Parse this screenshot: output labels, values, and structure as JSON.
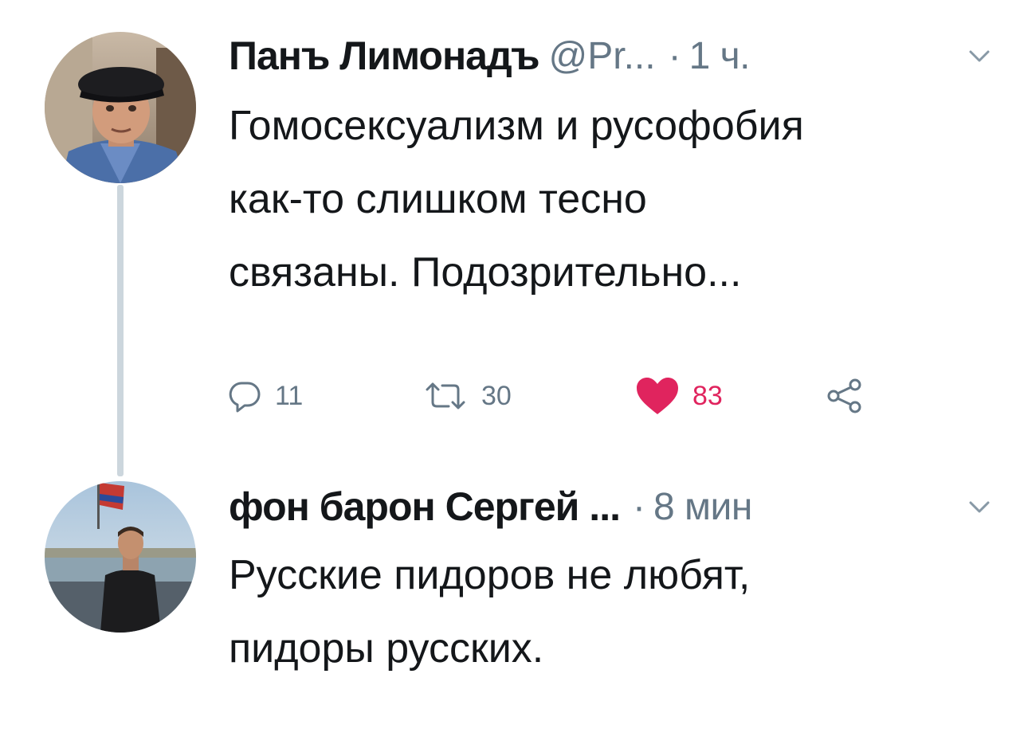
{
  "thread": {
    "tweets": [
      {
        "author_name": "Панъ Лимонадъ",
        "handle": "@Pr...",
        "separator": "·",
        "time": "1 ч.",
        "avatar_icon": "avatar-man-in-cap",
        "text_lines": [
          "Гомосексуализм и русофобия",
          "как-то слишком тесно",
          "связаны. Подозрительно..."
        ],
        "actions": {
          "reply": {
            "icon": "reply-icon",
            "count": "11"
          },
          "retweet": {
            "icon": "retweet-icon",
            "count": "30"
          },
          "like": {
            "icon": "heart-icon",
            "count": "83",
            "liked": true
          },
          "share": {
            "icon": "share-icon"
          }
        }
      },
      {
        "author_name": "фон барон Сергей ...",
        "separator": "·",
        "time": "8 мин",
        "avatar_icon": "avatar-man-outdoors",
        "text_lines": [
          "Русские пидоров не любят,",
          "пидоры русских."
        ]
      }
    ]
  },
  "colors": {
    "text_primary": "#14171a",
    "text_secondary": "#657786",
    "like_active": "#e0245e",
    "thread_line": "#ccd6dd"
  }
}
